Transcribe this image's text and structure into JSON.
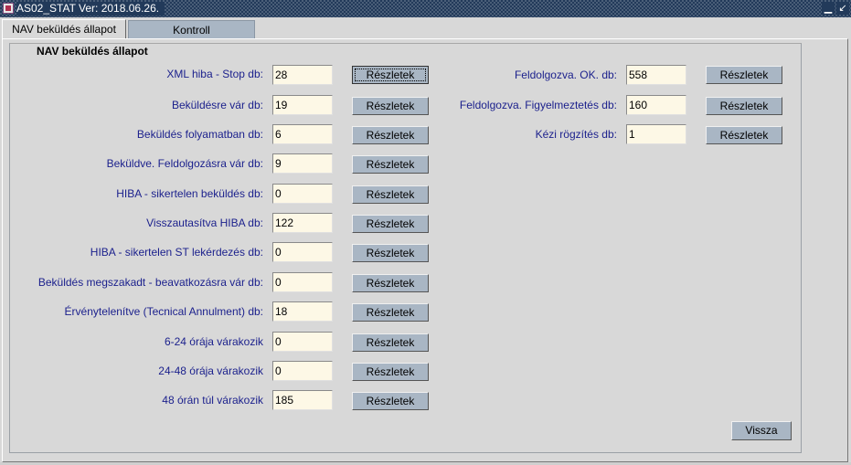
{
  "window": {
    "title": "AS02_STAT Ver: 2018.06.26."
  },
  "tabs": [
    {
      "label": "NAV beküldés állapot"
    },
    {
      "label": "Kontroll"
    }
  ],
  "panel": {
    "title": "NAV beküldés állapot"
  },
  "details_label": "Részletek",
  "left_rows": [
    {
      "label": "XML hiba - Stop db:",
      "value": "28"
    },
    {
      "label": "Beküldésre vár db:",
      "value": "19"
    },
    {
      "label": "Beküldés folyamatban db:",
      "value": "6"
    },
    {
      "label": "Beküldve. Feldolgozásra vár db:",
      "value": "9"
    },
    {
      "label": "HIBA - sikertelen beküldés db:",
      "value": "0"
    },
    {
      "label": "Visszautasítva HIBA db:",
      "value": "122"
    },
    {
      "label": "HIBA - sikertelen ST lekérdezés db:",
      "value": "0"
    },
    {
      "label": "Beküldés megszakadt - beavatkozásra vár db:",
      "value": "0"
    },
    {
      "label": "Érvénytelenítve (Tecnical Annulment) db:",
      "value": "18"
    },
    {
      "label": "6-24 órája várakozik",
      "value": "0"
    },
    {
      "label": "24-48 órája várakozik",
      "value": "0"
    },
    {
      "label": "48 órán túl várakozik",
      "value": "185"
    }
  ],
  "right_rows": [
    {
      "label": "Feldolgozva. OK. db:",
      "value": "558"
    },
    {
      "label": "Feldolgozva. Figyelmeztetés db:",
      "value": "160"
    },
    {
      "label": "Kézi rögzítés db:",
      "value": "1"
    }
  ],
  "back_button": {
    "label": "Vissza"
  }
}
